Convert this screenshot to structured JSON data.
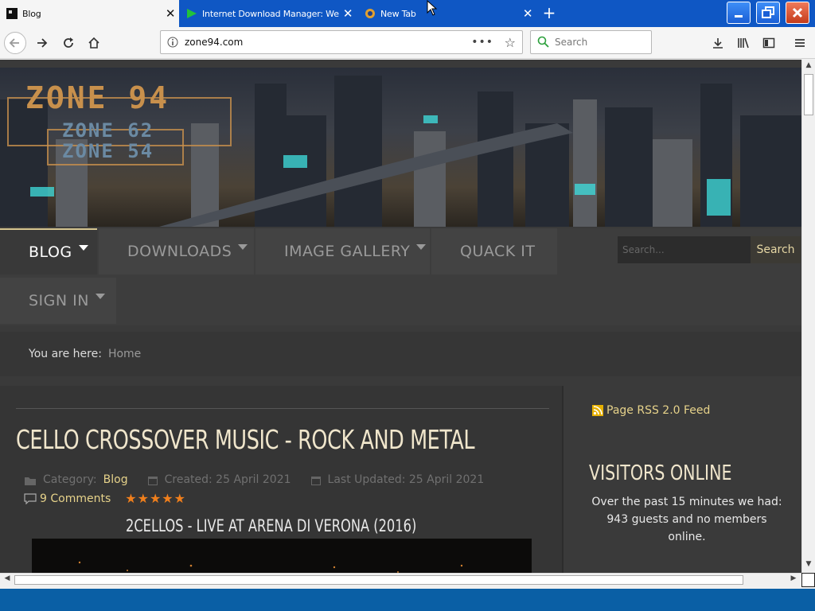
{
  "browser": {
    "tabs": [
      {
        "title": "Blog",
        "active": true
      },
      {
        "title": "Internet Download Manager: Web",
        "active": false
      },
      {
        "title": "New Tab",
        "active": false
      }
    ],
    "url": "zone94.com",
    "search_placeholder": "Search"
  },
  "site": {
    "logo_main": "ZONE 94",
    "logo_sub1": "ZONE 62",
    "logo_sub2": "ZONE 54",
    "menu": [
      {
        "label": "BLOG",
        "dropdown": true,
        "active": true
      },
      {
        "label": "DOWNLOADS",
        "dropdown": true
      },
      {
        "label": "IMAGE GALLERY",
        "dropdown": true
      },
      {
        "label": "QUACK IT",
        "dropdown": false
      },
      {
        "label": "SIGN IN",
        "dropdown": true
      }
    ],
    "search_placeholder": "Search...",
    "search_button": "Search",
    "breadcrumb_label": "You are here:",
    "breadcrumb_home": "Home"
  },
  "article": {
    "title": "CELLO CROSSOVER MUSIC - ROCK AND METAL",
    "category_label": "Category:",
    "category": "Blog",
    "created": "Created: 25 April 2021",
    "updated": "Last Updated: 25 April 2021",
    "comments": "9 Comments",
    "rating": 5,
    "video_title": "2CELLOS - LIVE AT ARENA DI VERONA (2016)"
  },
  "sidebar": {
    "rss": "Page RSS 2.0 Feed",
    "visitors_title": "VISITORS ONLINE",
    "visitors_text": "Over the past 15 minutes we had: 943 guests and no members online."
  },
  "colors": {
    "accent": "#e6d28a",
    "star": "#f07f1c",
    "titlebar": "#0f57c4"
  }
}
